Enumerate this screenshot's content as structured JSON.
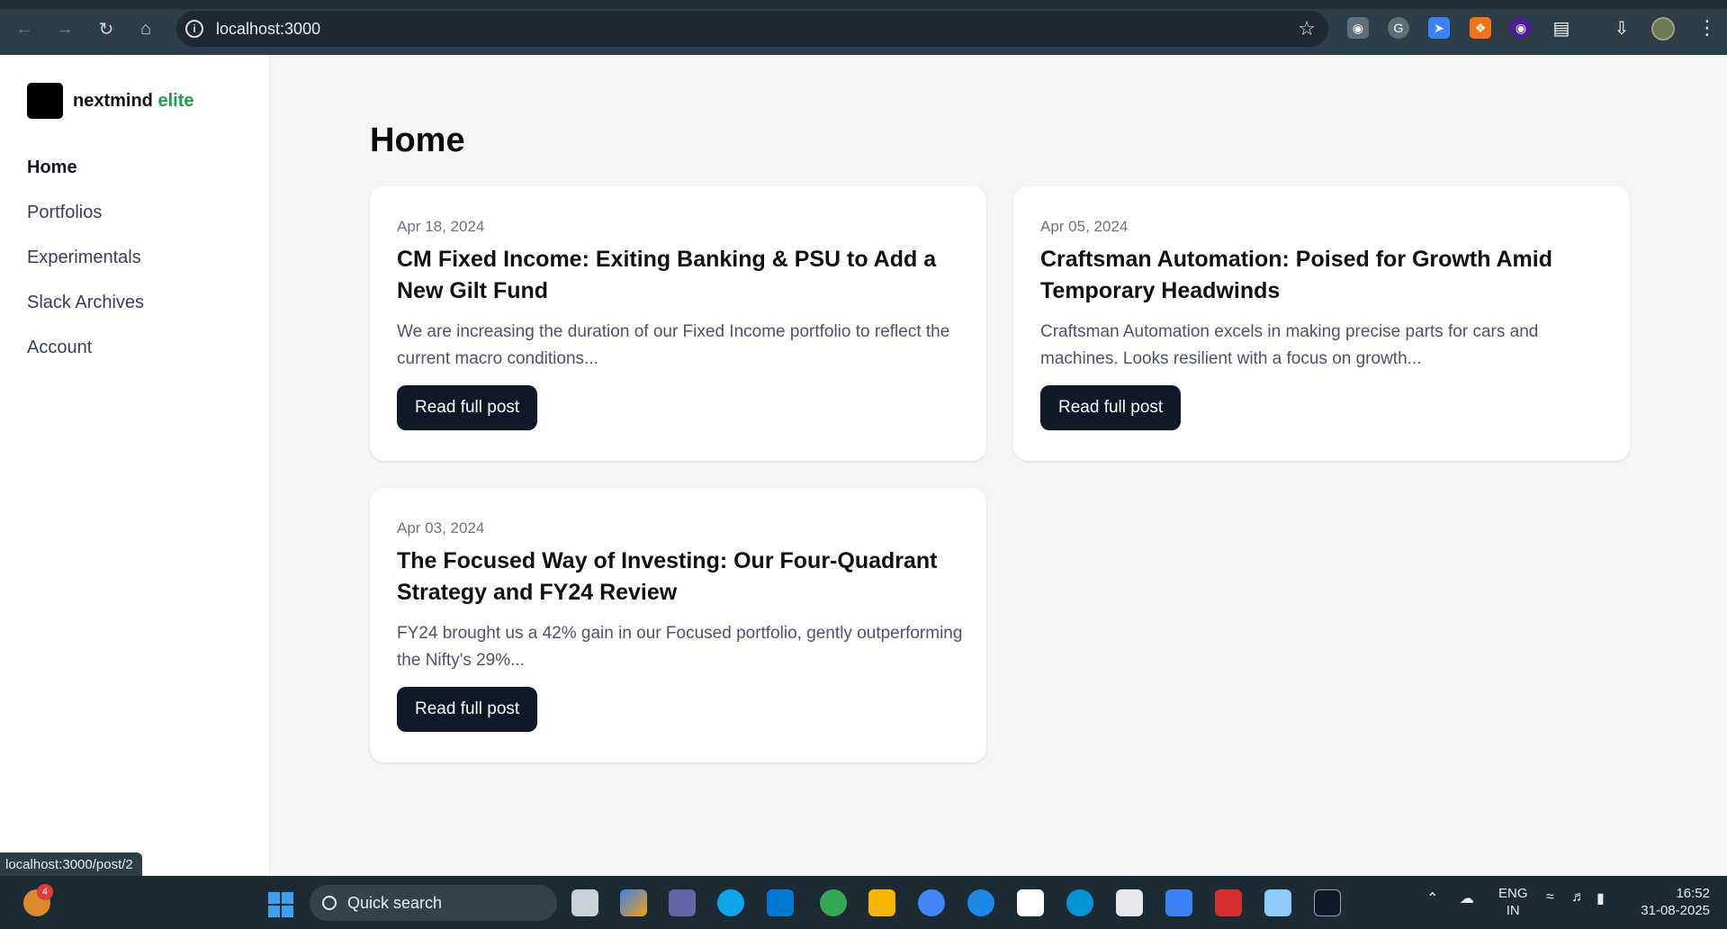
{
  "browser": {
    "url": "localhost:3000",
    "status_url": "localhost:3000/post/2"
  },
  "brand": {
    "name": "nextmind",
    "accent": "elite",
    "accent_color": "#16a34a"
  },
  "sidebar": {
    "items": [
      {
        "label": "Home",
        "active": true
      },
      {
        "label": "Portfolios"
      },
      {
        "label": "Experimentals"
      },
      {
        "label": "Slack Archives"
      },
      {
        "label": "Account"
      }
    ]
  },
  "main": {
    "title": "Home",
    "posts": [
      {
        "date": "Apr 18, 2024",
        "title": "CM Fixed Income: Exiting Banking & PSU to Add a New Gilt Fund",
        "excerpt": "We are increasing the duration of our Fixed Income portfolio to reflect the current macro conditions...",
        "button": "Read full post"
      },
      {
        "date": "Apr 05, 2024",
        "title": "Craftsman Automation: Poised for Growth Amid Temporary Headwinds",
        "excerpt": "Craftsman Automation excels in making precise parts for cars and machines. Looks resilient with a focus on growth...",
        "button": "Read full post"
      },
      {
        "date": "Apr 03, 2024",
        "title": "The Focused Way of Investing: Our Four-Quadrant Strategy and FY24 Review",
        "excerpt": "FY24 brought us a 42% gain in our Focused portfolio, gently outperforming the Nifty's 29%...",
        "button": "Read full post"
      }
    ]
  },
  "taskbar": {
    "widget_badge": "4",
    "search_label": "Quick search",
    "lang_1": "ENG",
    "lang_2": "IN",
    "time": "16:52",
    "date": "31-08-2025"
  }
}
